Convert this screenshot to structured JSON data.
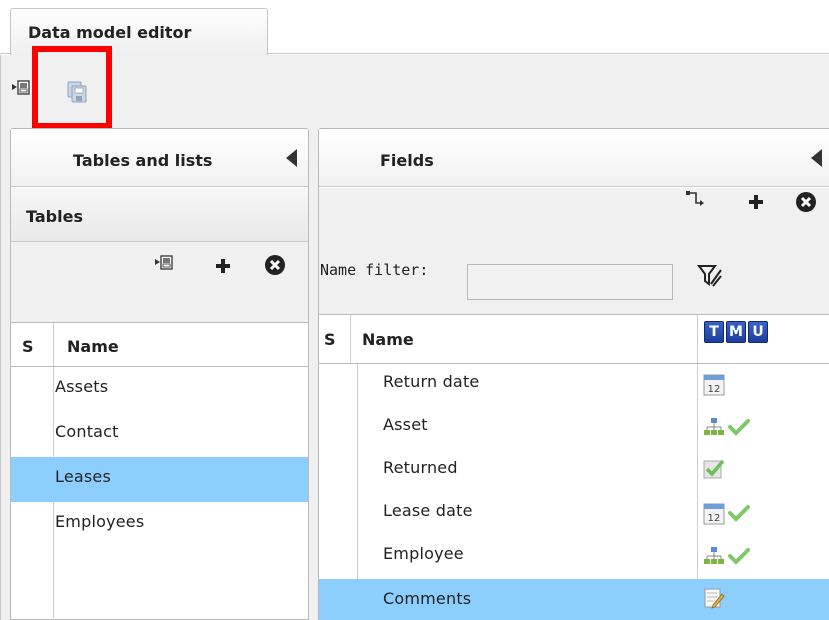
{
  "tab": {
    "title": "Data model editor"
  },
  "left_panel": {
    "title": "Tables and lists",
    "section": "Tables",
    "columns": {
      "s": "S",
      "name": "Name"
    },
    "rows": [
      {
        "name": "Assets",
        "selected": false
      },
      {
        "name": "Contact",
        "selected": false
      },
      {
        "name": "Leases",
        "selected": true
      },
      {
        "name": "Employees",
        "selected": false
      }
    ]
  },
  "right_panel": {
    "title": "Fields",
    "filter_label": "Name filter:",
    "filter_value": "",
    "columns": {
      "s": "S",
      "name": "Name",
      "badges": [
        "T",
        "M",
        "U"
      ]
    },
    "rows": [
      {
        "name": "Return date",
        "type_icon": "calendar-icon",
        "check": false,
        "selected": false
      },
      {
        "name": "Asset",
        "type_icon": "hierarchy-icon",
        "check": true,
        "selected": false
      },
      {
        "name": "Returned",
        "type_icon": "checkbox-icon",
        "check": false,
        "selected": false
      },
      {
        "name": "Lease date",
        "type_icon": "calendar-icon",
        "check": true,
        "selected": false
      },
      {
        "name": "Employee",
        "type_icon": "hierarchy-icon",
        "check": true,
        "selected": false
      },
      {
        "name": "Comments",
        "type_icon": "note-icon",
        "check": false,
        "selected": true
      }
    ]
  },
  "colors": {
    "selection": "#8ccfff",
    "highlight": "#ff0000",
    "badge": "#1b3f9c",
    "check": "#7ec86a"
  },
  "calendar_day": "12"
}
